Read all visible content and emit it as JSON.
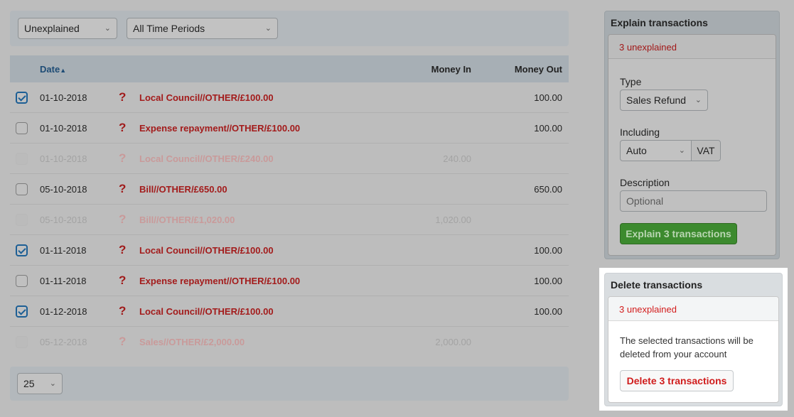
{
  "filters": {
    "status": "Unexplained",
    "period": "All Time Periods"
  },
  "table": {
    "headers": {
      "date": "Date",
      "money_in": "Money In",
      "money_out": "Money Out",
      "sort_indicator": "▲"
    },
    "rows": [
      {
        "checked": true,
        "disabled": false,
        "date": "01-10-2018",
        "icon": "?",
        "description": "Local Council//OTHER/£100.00",
        "money_in": "",
        "money_out": "100.00"
      },
      {
        "checked": false,
        "disabled": false,
        "date": "01-10-2018",
        "icon": "?",
        "description": "Expense repayment//OTHER/£100.00",
        "money_in": "",
        "money_out": "100.00"
      },
      {
        "checked": false,
        "disabled": true,
        "date": "01-10-2018",
        "icon": "?",
        "description": "Local Council//OTHER/£240.00",
        "money_in": "240.00",
        "money_out": ""
      },
      {
        "checked": false,
        "disabled": false,
        "date": "05-10-2018",
        "icon": "?",
        "description": "Bill//OTHER/£650.00",
        "money_in": "",
        "money_out": "650.00"
      },
      {
        "checked": false,
        "disabled": true,
        "date": "05-10-2018",
        "icon": "?",
        "description": "Bill//OTHER/£1,020.00",
        "money_in": "1,020.00",
        "money_out": ""
      },
      {
        "checked": true,
        "disabled": false,
        "date": "01-11-2018",
        "icon": "?",
        "description": "Local Council//OTHER/£100.00",
        "money_in": "",
        "money_out": "100.00"
      },
      {
        "checked": false,
        "disabled": false,
        "date": "01-11-2018",
        "icon": "?",
        "description": "Expense repayment//OTHER/£100.00",
        "money_in": "",
        "money_out": "100.00"
      },
      {
        "checked": true,
        "disabled": false,
        "date": "01-12-2018",
        "icon": "?",
        "description": "Local Council//OTHER/£100.00",
        "money_in": "",
        "money_out": "100.00"
      },
      {
        "checked": false,
        "disabled": true,
        "date": "05-12-2018",
        "icon": "?",
        "description": "Sales//OTHER/£2,000.00",
        "money_in": "2,000.00",
        "money_out": ""
      }
    ]
  },
  "pager": {
    "per_page": "25"
  },
  "explain_panel": {
    "title": "Explain transactions",
    "count_text": "3 unexplained",
    "type_label": "Type",
    "type_value": "Sales Refund",
    "including_label": "Including",
    "including_value": "Auto",
    "including_suffix": "VAT",
    "description_label": "Description",
    "description_placeholder": "Optional",
    "submit_label": "Explain 3 transactions",
    "accent_color": "#3c8a2e"
  },
  "delete_panel": {
    "title": "Delete transactions",
    "count_text": "3 unexplained",
    "message": "The selected transactions will be deleted from your account",
    "submit_label": "Delete 3 transactions",
    "accent_color": "#d01c1c"
  },
  "icons": {
    "chevron": "⌄",
    "unexplained": "?"
  }
}
